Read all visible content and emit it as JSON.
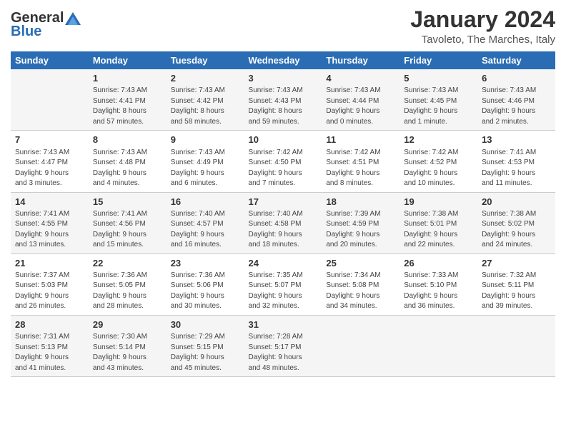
{
  "logo": {
    "general": "General",
    "blue": "Blue"
  },
  "header": {
    "month": "January 2024",
    "location": "Tavoleto, The Marches, Italy"
  },
  "days_of_week": [
    "Sunday",
    "Monday",
    "Tuesday",
    "Wednesday",
    "Thursday",
    "Friday",
    "Saturday"
  ],
  "weeks": [
    [
      {
        "day": "",
        "info": ""
      },
      {
        "day": "1",
        "info": "Sunrise: 7:43 AM\nSunset: 4:41 PM\nDaylight: 8 hours\nand 57 minutes."
      },
      {
        "day": "2",
        "info": "Sunrise: 7:43 AM\nSunset: 4:42 PM\nDaylight: 8 hours\nand 58 minutes."
      },
      {
        "day": "3",
        "info": "Sunrise: 7:43 AM\nSunset: 4:43 PM\nDaylight: 8 hours\nand 59 minutes."
      },
      {
        "day": "4",
        "info": "Sunrise: 7:43 AM\nSunset: 4:44 PM\nDaylight: 9 hours\nand 0 minutes."
      },
      {
        "day": "5",
        "info": "Sunrise: 7:43 AM\nSunset: 4:45 PM\nDaylight: 9 hours\nand 1 minute."
      },
      {
        "day": "6",
        "info": "Sunrise: 7:43 AM\nSunset: 4:46 PM\nDaylight: 9 hours\nand 2 minutes."
      }
    ],
    [
      {
        "day": "7",
        "info": "Sunrise: 7:43 AM\nSunset: 4:47 PM\nDaylight: 9 hours\nand 3 minutes."
      },
      {
        "day": "8",
        "info": "Sunrise: 7:43 AM\nSunset: 4:48 PM\nDaylight: 9 hours\nand 4 minutes."
      },
      {
        "day": "9",
        "info": "Sunrise: 7:43 AM\nSunset: 4:49 PM\nDaylight: 9 hours\nand 6 minutes."
      },
      {
        "day": "10",
        "info": "Sunrise: 7:42 AM\nSunset: 4:50 PM\nDaylight: 9 hours\nand 7 minutes."
      },
      {
        "day": "11",
        "info": "Sunrise: 7:42 AM\nSunset: 4:51 PM\nDaylight: 9 hours\nand 8 minutes."
      },
      {
        "day": "12",
        "info": "Sunrise: 7:42 AM\nSunset: 4:52 PM\nDaylight: 9 hours\nand 10 minutes."
      },
      {
        "day": "13",
        "info": "Sunrise: 7:41 AM\nSunset: 4:53 PM\nDaylight: 9 hours\nand 11 minutes."
      }
    ],
    [
      {
        "day": "14",
        "info": "Sunrise: 7:41 AM\nSunset: 4:55 PM\nDaylight: 9 hours\nand 13 minutes."
      },
      {
        "day": "15",
        "info": "Sunrise: 7:41 AM\nSunset: 4:56 PM\nDaylight: 9 hours\nand 15 minutes."
      },
      {
        "day": "16",
        "info": "Sunrise: 7:40 AM\nSunset: 4:57 PM\nDaylight: 9 hours\nand 16 minutes."
      },
      {
        "day": "17",
        "info": "Sunrise: 7:40 AM\nSunset: 4:58 PM\nDaylight: 9 hours\nand 18 minutes."
      },
      {
        "day": "18",
        "info": "Sunrise: 7:39 AM\nSunset: 4:59 PM\nDaylight: 9 hours\nand 20 minutes."
      },
      {
        "day": "19",
        "info": "Sunrise: 7:38 AM\nSunset: 5:01 PM\nDaylight: 9 hours\nand 22 minutes."
      },
      {
        "day": "20",
        "info": "Sunrise: 7:38 AM\nSunset: 5:02 PM\nDaylight: 9 hours\nand 24 minutes."
      }
    ],
    [
      {
        "day": "21",
        "info": "Sunrise: 7:37 AM\nSunset: 5:03 PM\nDaylight: 9 hours\nand 26 minutes."
      },
      {
        "day": "22",
        "info": "Sunrise: 7:36 AM\nSunset: 5:05 PM\nDaylight: 9 hours\nand 28 minutes."
      },
      {
        "day": "23",
        "info": "Sunrise: 7:36 AM\nSunset: 5:06 PM\nDaylight: 9 hours\nand 30 minutes."
      },
      {
        "day": "24",
        "info": "Sunrise: 7:35 AM\nSunset: 5:07 PM\nDaylight: 9 hours\nand 32 minutes."
      },
      {
        "day": "25",
        "info": "Sunrise: 7:34 AM\nSunset: 5:08 PM\nDaylight: 9 hours\nand 34 minutes."
      },
      {
        "day": "26",
        "info": "Sunrise: 7:33 AM\nSunset: 5:10 PM\nDaylight: 9 hours\nand 36 minutes."
      },
      {
        "day": "27",
        "info": "Sunrise: 7:32 AM\nSunset: 5:11 PM\nDaylight: 9 hours\nand 39 minutes."
      }
    ],
    [
      {
        "day": "28",
        "info": "Sunrise: 7:31 AM\nSunset: 5:13 PM\nDaylight: 9 hours\nand 41 minutes."
      },
      {
        "day": "29",
        "info": "Sunrise: 7:30 AM\nSunset: 5:14 PM\nDaylight: 9 hours\nand 43 minutes."
      },
      {
        "day": "30",
        "info": "Sunrise: 7:29 AM\nSunset: 5:15 PM\nDaylight: 9 hours\nand 45 minutes."
      },
      {
        "day": "31",
        "info": "Sunrise: 7:28 AM\nSunset: 5:17 PM\nDaylight: 9 hours\nand 48 minutes."
      },
      {
        "day": "",
        "info": ""
      },
      {
        "day": "",
        "info": ""
      },
      {
        "day": "",
        "info": ""
      }
    ]
  ]
}
